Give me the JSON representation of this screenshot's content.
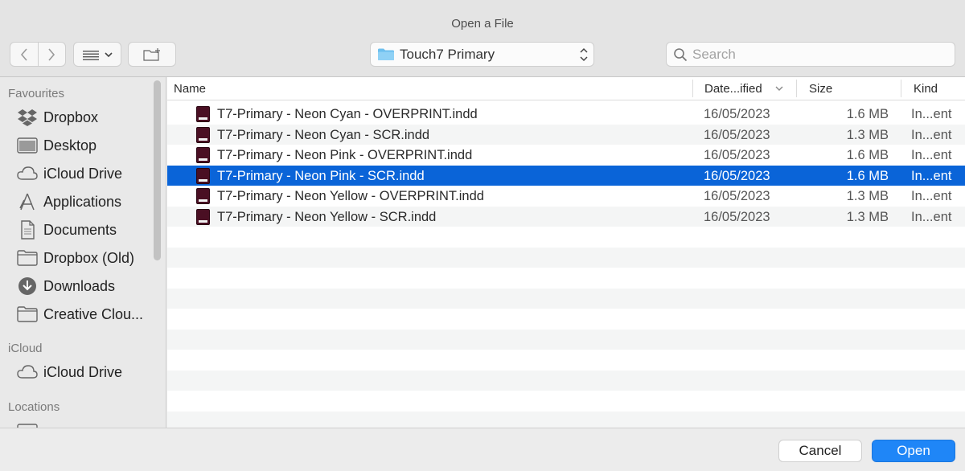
{
  "window": {
    "title": "Open a File"
  },
  "toolbar": {
    "location_popup": "Touch7 Primary",
    "search_placeholder": "Search"
  },
  "sidebar": {
    "sections": [
      {
        "heading": "Favourites",
        "items": [
          {
            "label": "Dropbox",
            "icon": "dropbox-icon"
          },
          {
            "label": "Desktop",
            "icon": "desktop-icon"
          },
          {
            "label": "iCloud Drive",
            "icon": "cloud-icon"
          },
          {
            "label": "Applications",
            "icon": "applications-icon"
          },
          {
            "label": "Documents",
            "icon": "document-icon"
          },
          {
            "label": "Dropbox (Old)",
            "icon": "folder-icon"
          },
          {
            "label": "Downloads",
            "icon": "download-icon"
          },
          {
            "label": "Creative Clou...",
            "icon": "folder-icon"
          }
        ]
      },
      {
        "heading": "iCloud",
        "items": [
          {
            "label": "iCloud Drive",
            "icon": "cloud-icon"
          }
        ]
      },
      {
        "heading": "Locations",
        "items": []
      }
    ]
  },
  "columns": {
    "name": "Name",
    "date": "Date...ified",
    "size": "Size",
    "kind": "Kind"
  },
  "files": [
    {
      "name": "T7-Primary - Neon Cyan - OVERPRINT.indd",
      "date": "16/05/2023",
      "size": "1.6 MB",
      "kind": "In...ent",
      "selected": false
    },
    {
      "name": "T7-Primary - Neon Cyan - SCR.indd",
      "date": "16/05/2023",
      "size": "1.3 MB",
      "kind": "In...ent",
      "selected": false
    },
    {
      "name": "T7-Primary - Neon Pink - OVERPRINT.indd",
      "date": "16/05/2023",
      "size": "1.6 MB",
      "kind": "In...ent",
      "selected": false
    },
    {
      "name": "T7-Primary - Neon Pink - SCR.indd",
      "date": "16/05/2023",
      "size": "1.6 MB",
      "kind": "In...ent",
      "selected": true
    },
    {
      "name": "T7-Primary - Neon Yellow - OVERPRINT.indd",
      "date": "16/05/2023",
      "size": "1.3 MB",
      "kind": "In...ent",
      "selected": false
    },
    {
      "name": "T7-Primary - Neon Yellow - SCR.indd",
      "date": "16/05/2023",
      "size": "1.3 MB",
      "kind": "In...ent",
      "selected": false
    }
  ],
  "footer": {
    "cancel": "Cancel",
    "open": "Open"
  },
  "colors": {
    "selection": "#0a64d8",
    "accent_button": "#1f86f7",
    "indesign_icon": "#4a0f23"
  }
}
